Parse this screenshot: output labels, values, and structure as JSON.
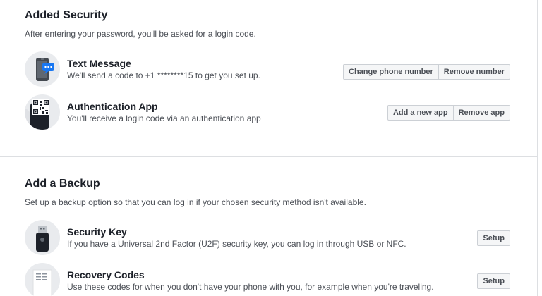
{
  "added_security": {
    "title": "Added Security",
    "description": "After entering your password, you'll be asked for a login code.",
    "methods": [
      {
        "icon": "phone-message-icon",
        "title": "Text Message",
        "description": "We'll send a code to +1 ********15 to get you set up.",
        "buttons": [
          "Change phone number",
          "Remove number"
        ]
      },
      {
        "icon": "qr-code-phone-icon",
        "title": "Authentication App",
        "description": "You'll receive a login code via an authentication app",
        "buttons": [
          "Add a new app",
          "Remove app"
        ]
      }
    ]
  },
  "add_backup": {
    "title": "Add a Backup",
    "description": "Set up a backup option so that you can log in if your chosen security method isn't available.",
    "methods": [
      {
        "icon": "usb-security-key-icon",
        "title": "Security Key",
        "description": "If you have a Universal 2nd Factor (U2F) security key, you can log in through USB or NFC.",
        "buttons": [
          "Setup"
        ]
      },
      {
        "icon": "recovery-codes-document-icon",
        "title": "Recovery Codes",
        "description": "Use these codes for when you don't have your phone with you, for example when you're traveling.",
        "buttons": [
          "Setup"
        ]
      }
    ]
  },
  "colors": {
    "title_text": "#1d2129",
    "secondary_text": "#4b4f56",
    "divider": "#dddfe2",
    "button_bg": "#f5f6f7",
    "button_border": "#ccd0d5",
    "icon_circle_bg": "#e9ebee",
    "accent_blue": "#1877f2"
  }
}
